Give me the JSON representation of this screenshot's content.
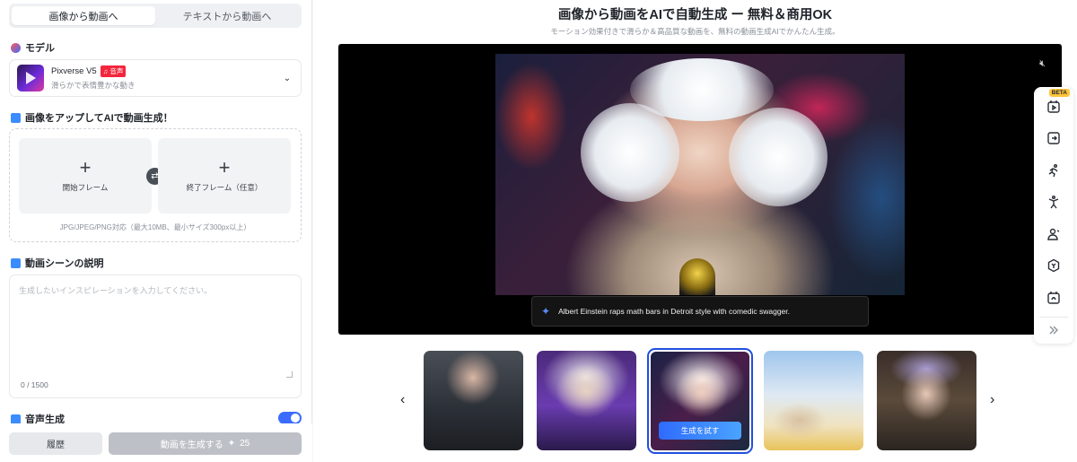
{
  "tabs": [
    {
      "label": "画像から動画へ",
      "active": true
    },
    {
      "label": "テキストから動画へ",
      "active": false
    }
  ],
  "model": {
    "section_title": "モデル",
    "name": "Pixverse V5",
    "badge": "音声",
    "description": "滑らかで表情豊かな動き"
  },
  "upload": {
    "section_title": "画像をアップしてAIで動画生成！",
    "start_frame": "開始フレーム",
    "end_frame": "終了フレーム（任意）",
    "hint": "JPG/JPEG/PNG対応（最大10MB、最小サイズ300px以上）"
  },
  "prompt": {
    "section_title": "動画シーンの説明",
    "placeholder": "生成したいインスピレーションを入力してください。",
    "counter": "0 / 1500"
  },
  "audio": {
    "section_title": "音声生成",
    "enabled": true
  },
  "footer": {
    "history_label": "履歴",
    "generate_label": "動画を生成する",
    "credits": "25"
  },
  "main": {
    "headline": "画像から動画をAIで自動生成 ー 無料＆商用OK",
    "subhead": "モーション効果付きで滑らか＆高品質な動画を、無料の動画生成AIでかんたん生成。",
    "caption": "Albert Einstein raps math bars in Detroit style with comedic swagger.",
    "try_label": "生成を試す"
  },
  "toolbar": {
    "beta": "BETA",
    "tools": [
      "image-to-video-icon",
      "frame-icon",
      "running-icon",
      "dance-icon",
      "character-icon",
      "shield-icon",
      "effects-icon",
      "collapse-icon"
    ]
  },
  "colors": {
    "accent": "#3b6cff",
    "selected_border": "#1f4fe0",
    "badge": "#f3263c",
    "beta": "#ffc53d"
  }
}
